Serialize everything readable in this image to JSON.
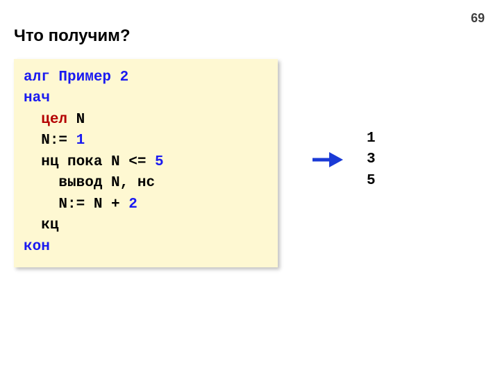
{
  "page_number": "69",
  "title": "Что получим?",
  "code": {
    "l1_kw": "алг",
    "l1_name": " Пример 2",
    "l2": "нач",
    "l3_kw": "цел",
    "l3_rest": " N",
    "l4_lhs": "N:=",
    "l4_num": " 1",
    "l5_lhs": "нц пока N <=",
    "l5_num": " 5",
    "l6": "вывод N, нс",
    "l7_lhs": "N:= N +",
    "l7_num": " 2",
    "l8": "кц",
    "l9": "кон"
  },
  "output": {
    "l1": "1",
    "l2": "3",
    "l3": "5"
  },
  "indent1": "  ",
  "indent2": "    "
}
